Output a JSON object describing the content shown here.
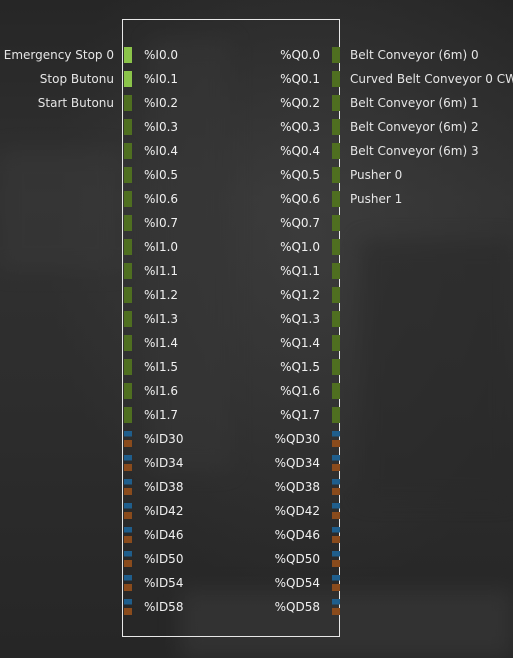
{
  "colors": {
    "bit_on": "#8bc34a",
    "bit_off": "#4f6f20",
    "analog_top": "#1f5e8c",
    "analog_bottom": "#8a4b1c",
    "panel_border": "#e8e8e8",
    "text": "#e6e6e6"
  },
  "io_rows": [
    {
      "in_label": "Emergency Stop 0",
      "in_addr": "%I0.0",
      "in_state": "on",
      "out_addr": "%Q0.0",
      "out_label": "Belt Conveyor (6m) 0",
      "out_state": "off"
    },
    {
      "in_label": "Stop Butonu",
      "in_addr": "%I0.1",
      "in_state": "on",
      "out_addr": "%Q0.1",
      "out_label": "Curved Belt Conveyor 0 CW",
      "out_state": "off"
    },
    {
      "in_label": "Start Butonu",
      "in_addr": "%I0.2",
      "in_state": "off",
      "out_addr": "%Q0.2",
      "out_label": "Belt Conveyor (6m) 1",
      "out_state": "off"
    },
    {
      "in_label": "",
      "in_addr": "%I0.3",
      "in_state": "off",
      "out_addr": "%Q0.3",
      "out_label": "Belt Conveyor (6m) 2",
      "out_state": "off"
    },
    {
      "in_label": "",
      "in_addr": "%I0.4",
      "in_state": "off",
      "out_addr": "%Q0.4",
      "out_label": "Belt Conveyor (6m) 3",
      "out_state": "off"
    },
    {
      "in_label": "",
      "in_addr": "%I0.5",
      "in_state": "off",
      "out_addr": "%Q0.5",
      "out_label": "Pusher 0",
      "out_state": "off"
    },
    {
      "in_label": "",
      "in_addr": "%I0.6",
      "in_state": "off",
      "out_addr": "%Q0.6",
      "out_label": "Pusher 1",
      "out_state": "off"
    },
    {
      "in_label": "",
      "in_addr": "%I0.7",
      "in_state": "off",
      "out_addr": "%Q0.7",
      "out_label": "",
      "out_state": "off"
    },
    {
      "in_label": "",
      "in_addr": "%I1.0",
      "in_state": "off",
      "out_addr": "%Q1.0",
      "out_label": "",
      "out_state": "off"
    },
    {
      "in_label": "",
      "in_addr": "%I1.1",
      "in_state": "off",
      "out_addr": "%Q1.1",
      "out_label": "",
      "out_state": "off"
    },
    {
      "in_label": "",
      "in_addr": "%I1.2",
      "in_state": "off",
      "out_addr": "%Q1.2",
      "out_label": "",
      "out_state": "off"
    },
    {
      "in_label": "",
      "in_addr": "%I1.3",
      "in_state": "off",
      "out_addr": "%Q1.3",
      "out_label": "",
      "out_state": "off"
    },
    {
      "in_label": "",
      "in_addr": "%I1.4",
      "in_state": "off",
      "out_addr": "%Q1.4",
      "out_label": "",
      "out_state": "off"
    },
    {
      "in_label": "",
      "in_addr": "%I1.5",
      "in_state": "off",
      "out_addr": "%Q1.5",
      "out_label": "",
      "out_state": "off"
    },
    {
      "in_label": "",
      "in_addr": "%I1.6",
      "in_state": "off",
      "out_addr": "%Q1.6",
      "out_label": "",
      "out_state": "off"
    },
    {
      "in_label": "",
      "in_addr": "%I1.7",
      "in_state": "off",
      "out_addr": "%Q1.7",
      "out_label": "",
      "out_state": "off"
    },
    {
      "in_label": "",
      "in_addr": "%ID30",
      "in_state": "analog",
      "out_addr": "%QD30",
      "out_label": "",
      "out_state": "analog"
    },
    {
      "in_label": "",
      "in_addr": "%ID34",
      "in_state": "analog",
      "out_addr": "%QD34",
      "out_label": "",
      "out_state": "analog"
    },
    {
      "in_label": "",
      "in_addr": "%ID38",
      "in_state": "analog",
      "out_addr": "%QD38",
      "out_label": "",
      "out_state": "analog"
    },
    {
      "in_label": "",
      "in_addr": "%ID42",
      "in_state": "analog",
      "out_addr": "%QD42",
      "out_label": "",
      "out_state": "analog"
    },
    {
      "in_label": "",
      "in_addr": "%ID46",
      "in_state": "analog",
      "out_addr": "%QD46",
      "out_label": "",
      "out_state": "analog"
    },
    {
      "in_label": "",
      "in_addr": "%ID50",
      "in_state": "analog",
      "out_addr": "%QD50",
      "out_label": "",
      "out_state": "analog"
    },
    {
      "in_label": "",
      "in_addr": "%ID54",
      "in_state": "analog",
      "out_addr": "%QD54",
      "out_label": "",
      "out_state": "analog"
    },
    {
      "in_label": "",
      "in_addr": "%ID58",
      "in_state": "analog",
      "out_addr": "%QD58",
      "out_label": "",
      "out_state": "analog"
    }
  ]
}
